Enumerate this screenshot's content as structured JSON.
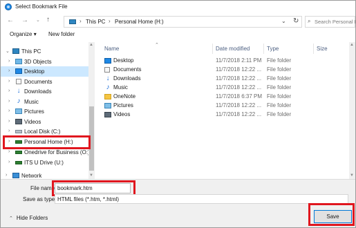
{
  "window": {
    "title": "Select Bookmark File"
  },
  "address": {
    "crumbs": [
      "This PC",
      "Personal Home (H:)"
    ],
    "search_placeholder": "Search Personal H"
  },
  "toolbar": {
    "organize": "Organize",
    "new_folder": "New folder"
  },
  "nav": {
    "items": [
      {
        "label": "This PC",
        "icon": "computer-icon"
      },
      {
        "label": "3D Objects",
        "icon": "3d-objects-icon"
      },
      {
        "label": "Desktop",
        "icon": "desktop-icon"
      },
      {
        "label": "Documents",
        "icon": "documents-icon"
      },
      {
        "label": "Downloads",
        "icon": "downloads-icon"
      },
      {
        "label": "Music",
        "icon": "music-icon"
      },
      {
        "label": "Pictures",
        "icon": "pictures-icon"
      },
      {
        "label": "Videos",
        "icon": "videos-icon"
      },
      {
        "label": "Local Disk (C:)",
        "icon": "drive-icon"
      },
      {
        "label": "Personal Home (H:)",
        "icon": "network-drive-icon"
      },
      {
        "label": "Onedrive for Business (O:)",
        "icon": "network-drive-icon"
      },
      {
        "label": "ITS U Drive (U:)",
        "icon": "network-drive-icon"
      },
      {
        "label": "Network",
        "icon": "network-icon"
      }
    ]
  },
  "files": {
    "columns": {
      "name": "Name",
      "date": "Date modified",
      "type": "Type",
      "size": "Size"
    },
    "rows": [
      {
        "name": "Desktop",
        "date": "11/7/2018 2:11 PM",
        "type": "File folder",
        "icon": "desktop-folder-icon"
      },
      {
        "name": "Documents",
        "date": "11/7/2018 12:22 ...",
        "type": "File folder",
        "icon": "documents-folder-icon"
      },
      {
        "name": "Downloads",
        "date": "11/7/2018 12:22 ...",
        "type": "File folder",
        "icon": "downloads-folder-icon"
      },
      {
        "name": "Music",
        "date": "11/7/2018 12:22 ...",
        "type": "File folder",
        "icon": "music-folder-icon"
      },
      {
        "name": "OneNote",
        "date": "11/7/2018 6:37 PM",
        "type": "File folder",
        "icon": "folder-icon"
      },
      {
        "name": "Pictures",
        "date": "11/7/2018 12:22 ...",
        "type": "File folder",
        "icon": "pictures-folder-icon"
      },
      {
        "name": "Videos",
        "date": "11/7/2018 12:22 ...",
        "type": "File folder",
        "icon": "videos-folder-icon"
      }
    ]
  },
  "form": {
    "file_name_label": "File name:",
    "file_name_value": "bookmark.htm",
    "save_as_type_label": "Save as type:",
    "save_as_type_value": "HTML files (*.htm, *.html)",
    "hide_folders": "Hide Folders",
    "save_button": "Save"
  },
  "highlight_color": "#e0161e",
  "selection_color": "#cce8ff"
}
